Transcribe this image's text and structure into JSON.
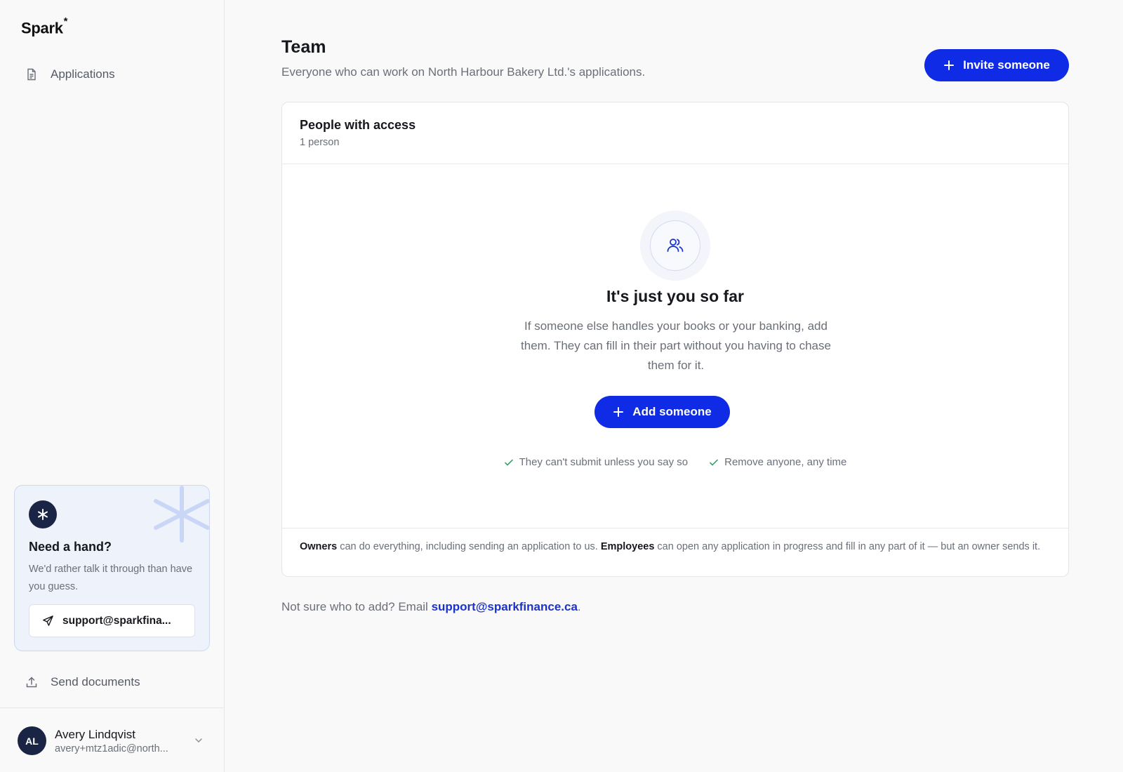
{
  "brand": {
    "name": "Spark",
    "mark": "*"
  },
  "sidebar": {
    "nav": [
      {
        "label": "Applications",
        "icon": "document-icon"
      },
      {
        "label": "Send documents",
        "icon": "upload-icon"
      }
    ],
    "help": {
      "title": "Need a hand?",
      "text": "We'd rather talk it through than have you guess.",
      "email": "support@sparkfina..."
    },
    "user": {
      "initials": "AL",
      "name": "Avery Lindqvist",
      "email": "avery+mtz1adic@north..."
    }
  },
  "main": {
    "title": "Team",
    "subtitle": "Everyone who can work on North Harbour Bakery Ltd.'s applications.",
    "invite_label": "Invite someone",
    "card": {
      "title": "People with access",
      "count": "1 person",
      "empty_title": "It's just you so far",
      "empty_text": "If someone else handles your books or your banking, add them. They can fill in their part without you having to chase them for it.",
      "add_label": "Add someone",
      "checks": [
        "They can't submit unless you say so",
        "Remove anyone, any time"
      ],
      "footer": {
        "owners": "Owners",
        "owners_text": " can do everything, including sending an application to us. ",
        "employees": "Employees",
        "employees_text": " can open any application in progress and fill in any part of it — but an owner sends it."
      }
    },
    "note": {
      "prefix": "Not sure who to add? Email ",
      "email": "support@sparkfinance.ca",
      "suffix": "."
    }
  },
  "colors": {
    "primary": "#0f2be6",
    "dark_badge": "#1a2444",
    "link": "#1a33c9",
    "check": "#3aa36b"
  }
}
